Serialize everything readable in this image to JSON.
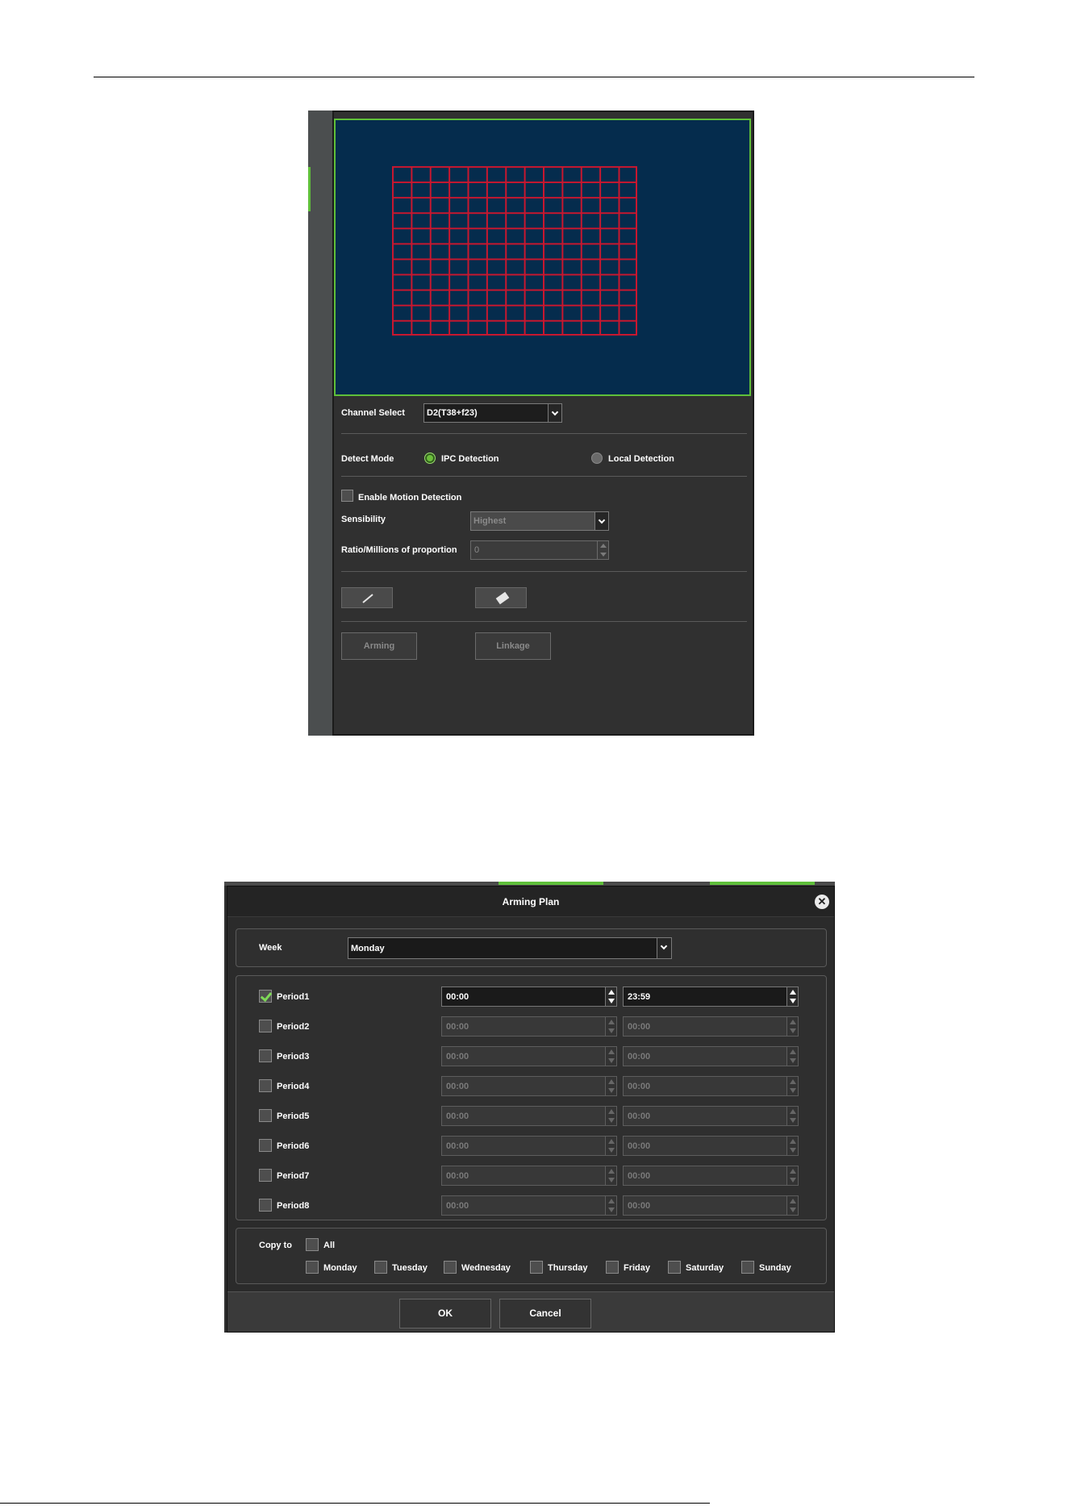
{
  "motion": {
    "channel_select_label": "Channel Select",
    "channel_value": "D2(T38+f23)",
    "detect_mode_label": "Detect Mode",
    "mode_ipc": "IPC Detection",
    "mode_local": "Local Detection",
    "enable_label": "Enable Motion Detection",
    "sensibility_label": "Sensibility",
    "sensibility_value": "Highest",
    "ratio_label": "Ratio/Millions of proportion",
    "ratio_value": "0",
    "arming_label": "Arming",
    "linkage_label": "Linkage",
    "icons": [
      "pencil-icon",
      "eraser-icon"
    ],
    "colors": {
      "video_bg": "#052c4d",
      "grid": "#c8172f",
      "accent": "#5fbf3a"
    }
  },
  "arming_plan": {
    "title": "Arming Plan",
    "week_label": "Week",
    "week_value": "Monday",
    "periods": [
      {
        "label": "Period1",
        "checked": true,
        "start": "00:00",
        "end": "23:59"
      },
      {
        "label": "Period2",
        "checked": false,
        "start": "00:00",
        "end": "00:00"
      },
      {
        "label": "Period3",
        "checked": false,
        "start": "00:00",
        "end": "00:00"
      },
      {
        "label": "Period4",
        "checked": false,
        "start": "00:00",
        "end": "00:00"
      },
      {
        "label": "Period5",
        "checked": false,
        "start": "00:00",
        "end": "00:00"
      },
      {
        "label": "Period6",
        "checked": false,
        "start": "00:00",
        "end": "00:00"
      },
      {
        "label": "Period7",
        "checked": false,
        "start": "00:00",
        "end": "00:00"
      },
      {
        "label": "Period8",
        "checked": false,
        "start": "00:00",
        "end": "00:00"
      }
    ],
    "copy_to_label": "Copy to",
    "all_label": "All",
    "days": [
      "Monday",
      "Tuesday",
      "Wednesday",
      "Thursday",
      "Friday",
      "Saturday",
      "Sunday"
    ],
    "ok_label": "OK",
    "cancel_label": "Cancel"
  }
}
